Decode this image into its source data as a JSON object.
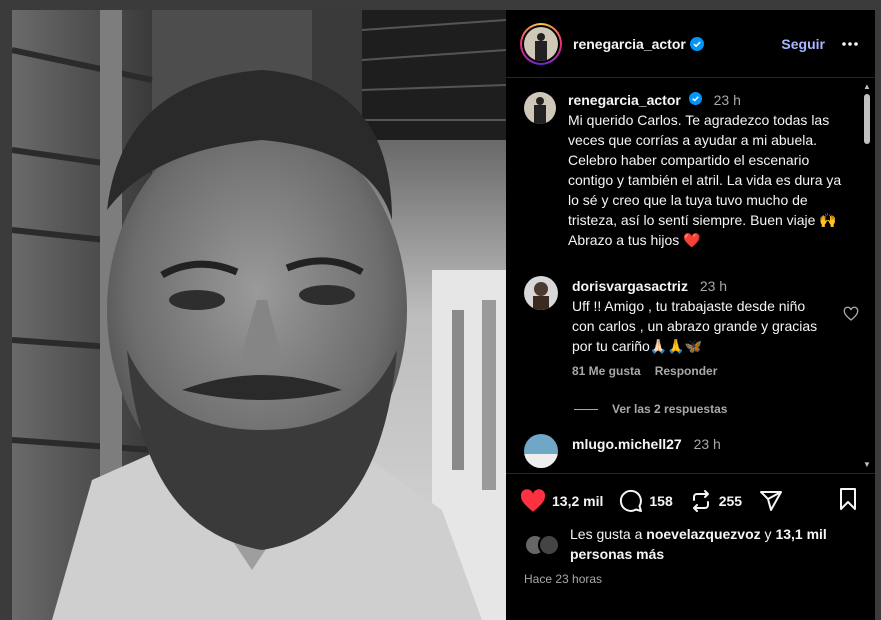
{
  "post": {
    "username": "renegarcia_actor",
    "follow_label": "Seguir"
  },
  "caption": {
    "username": "renegarcia_actor",
    "time": "23 h",
    "text": "Mi querido Carlos. Te agradezco todas las veces que corrías a ayudar a mi abuela. Celebro haber compartido el escenario contigo y también el atril. La vida es dura ya lo sé y creo que la tuya tuvo mucho de tristeza, así lo sentí siempre. Buen viaje 🙌 Abrazo a tus hijos ❤️"
  },
  "comments": [
    {
      "username": "dorisvargasactriz",
      "time": "23 h",
      "text": "Uff !! Amigo , tu trabajaste desde niño con carlos , un abrazo grande y gracias por tu cariño🙏🏻🙏🦋",
      "likes": "81 Me gusta",
      "reply_label": "Responder",
      "view_replies": "Ver las 2 respuestas"
    },
    {
      "username": "mlugo.michell27",
      "time": "23 h"
    }
  ],
  "actions": {
    "like_count": "13,2 mil",
    "comment_count": "158",
    "repost_count": "255"
  },
  "likes_summary": {
    "prefix": "Les gusta a",
    "user": "noevelazquezvoz",
    "conj": "y",
    "others": "13,1 mil personas más"
  },
  "posted_ago": "Hace 23 horas",
  "colors": {
    "accent_link": "#a8b8ff",
    "verified": "#0095f6",
    "like_red": "#ff3040",
    "panel_bg": "#000000"
  }
}
